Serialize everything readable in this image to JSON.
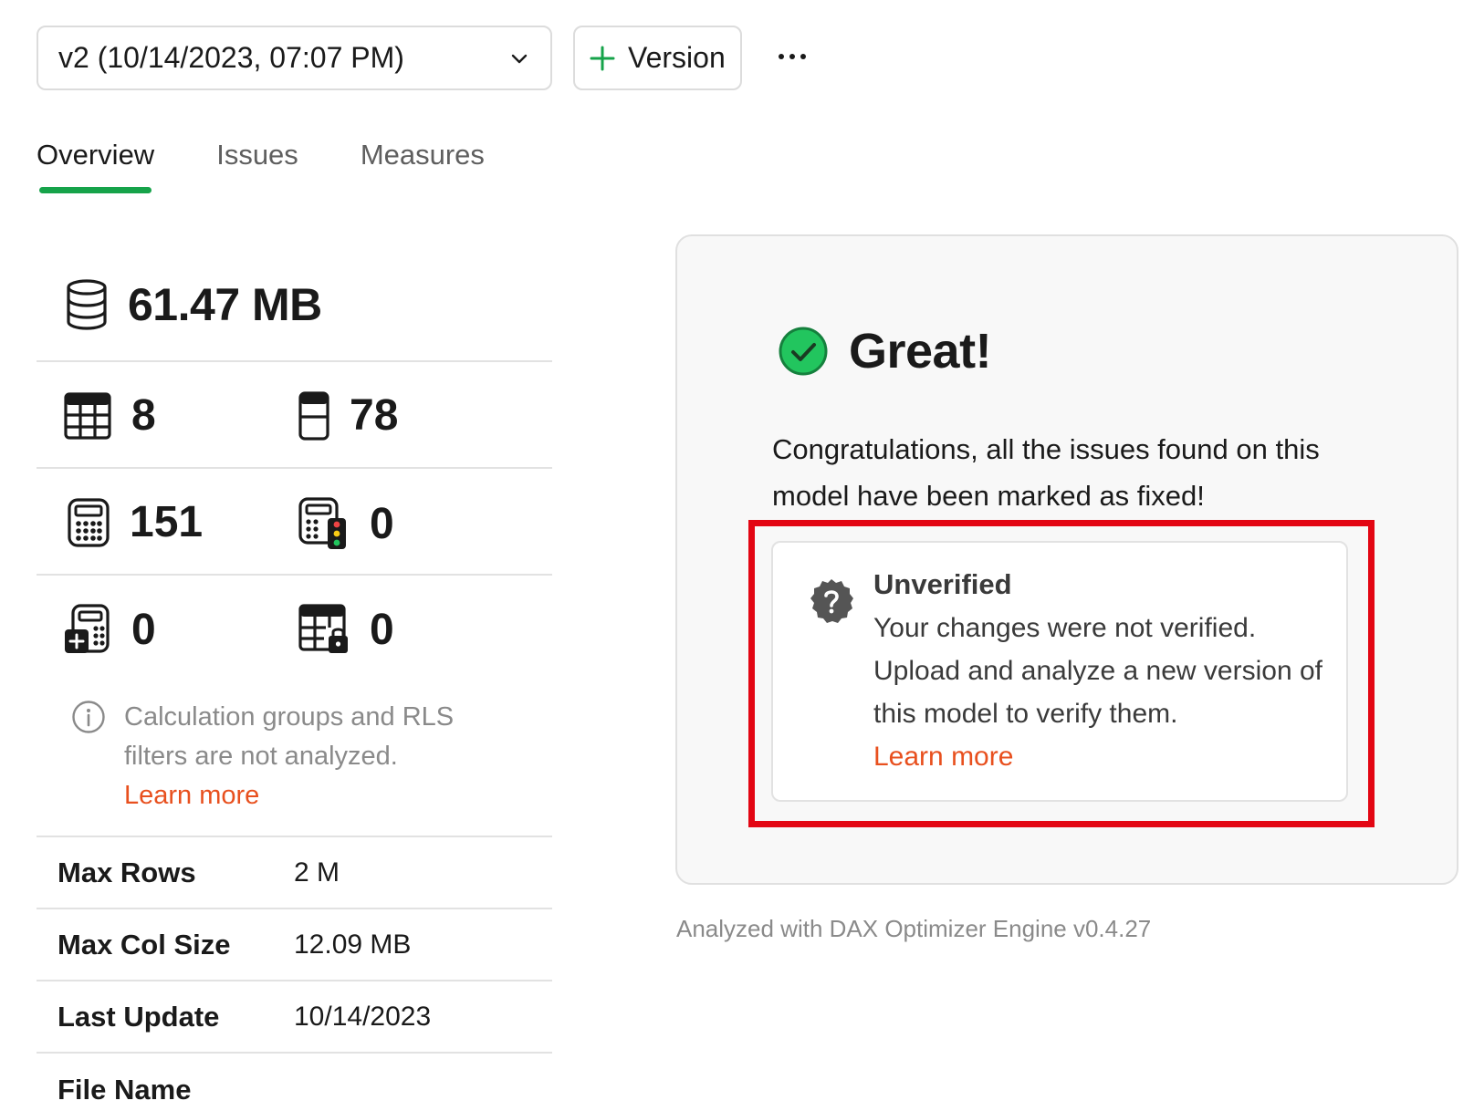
{
  "toolbar": {
    "version_selected": "v2 (10/14/2023, 07:07 PM)",
    "add_version_label": "Version"
  },
  "tabs": [
    {
      "label": "Overview",
      "active": true
    },
    {
      "label": "Issues",
      "active": false
    },
    {
      "label": "Measures",
      "active": false
    }
  ],
  "stats": {
    "model_size": "61.47 MB",
    "tables": "8",
    "columns": "78",
    "measures": "151",
    "measures_with_issues": "0",
    "calculation_groups": "0",
    "rls_tables": "0"
  },
  "note": {
    "text": "Calculation groups and RLS filters are not analyzed.",
    "link": "Learn more"
  },
  "properties": [
    {
      "key": "Max Rows",
      "value": "2 M"
    },
    {
      "key": "Max Col Size",
      "value": "12.09 MB"
    },
    {
      "key": "Last Update",
      "value": "10/14/2023"
    },
    {
      "key": "File Name",
      "value": ""
    }
  ],
  "status_card": {
    "title": "Great!",
    "message": "Congratulations, all the issues found on this model have been marked as fixed!",
    "unverified": {
      "title": "Unverified",
      "message": "Your changes were not verified. Upload and analyze a new version of this model to verify them.",
      "link": "Learn more"
    }
  },
  "footer": "Analyzed with DAX Optimizer Engine v0.4.27",
  "colors": {
    "accent_green": "#16a34a",
    "link_orange": "#e8501e",
    "highlight_red": "#e30613"
  }
}
